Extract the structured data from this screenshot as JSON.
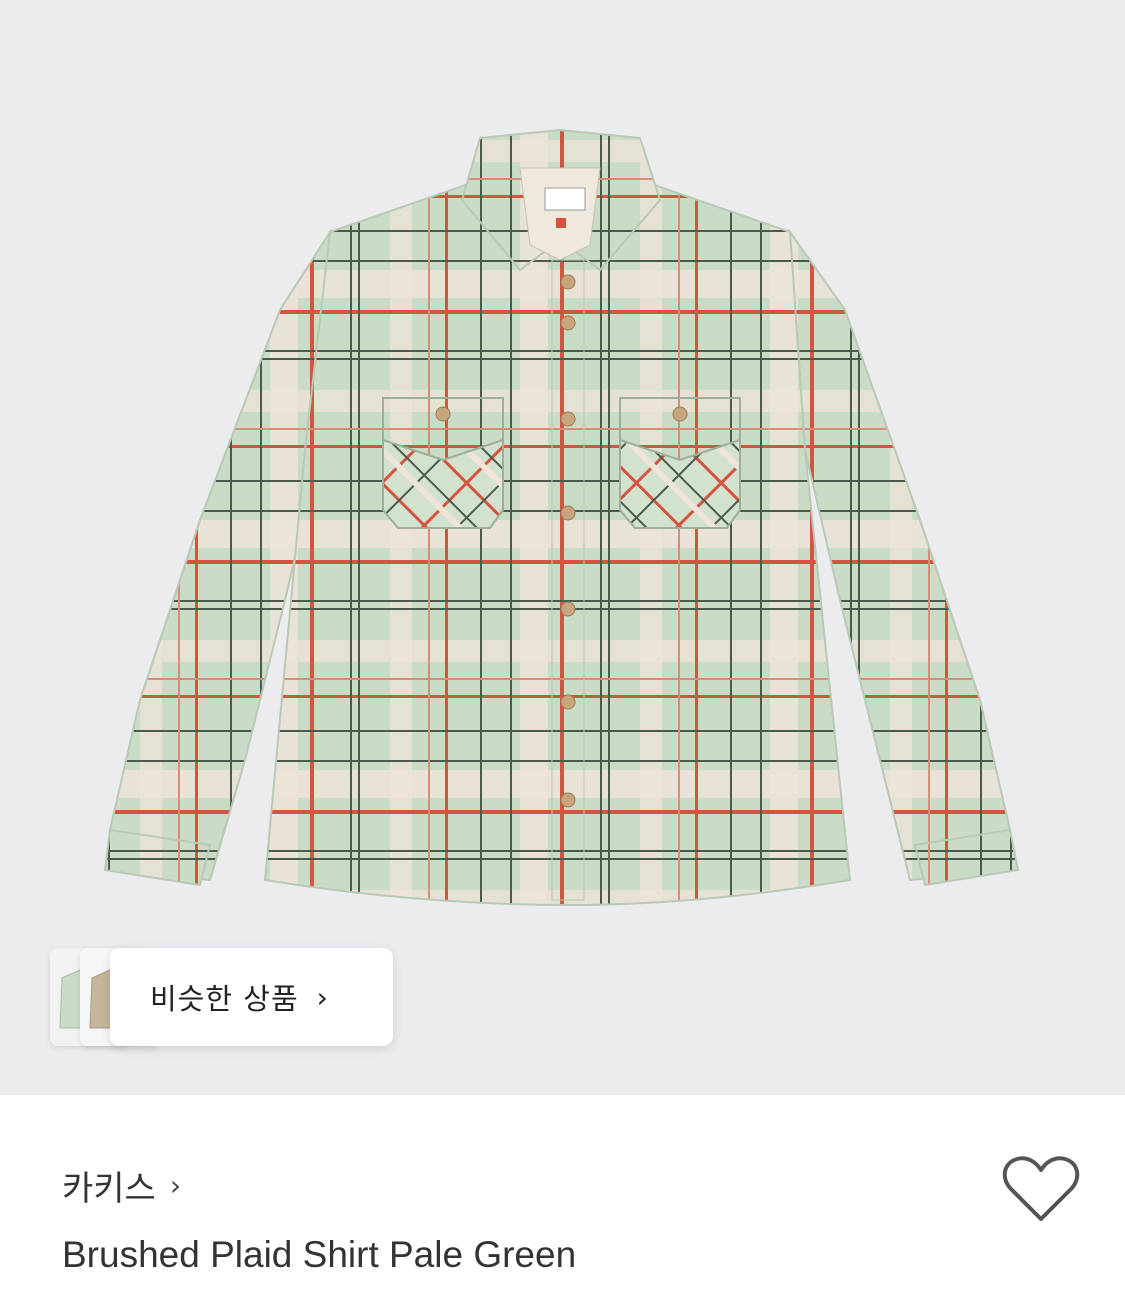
{
  "similar_products": {
    "label": "비슷한 상품",
    "chevron": "›"
  },
  "product": {
    "brand": "카키스",
    "brand_chevron": "›",
    "name": "Brushed Plaid Shirt Pale Green"
  },
  "icons": {
    "wishlist": "heart-outline-icon"
  },
  "colors": {
    "image_bg": "#ececef",
    "shirt_base": "#c9dcc6",
    "plaid_red": "#d4553f",
    "plaid_dark": "#4c5a4c",
    "plaid_cream": "#efe6dc",
    "text_primary": "#333333"
  }
}
